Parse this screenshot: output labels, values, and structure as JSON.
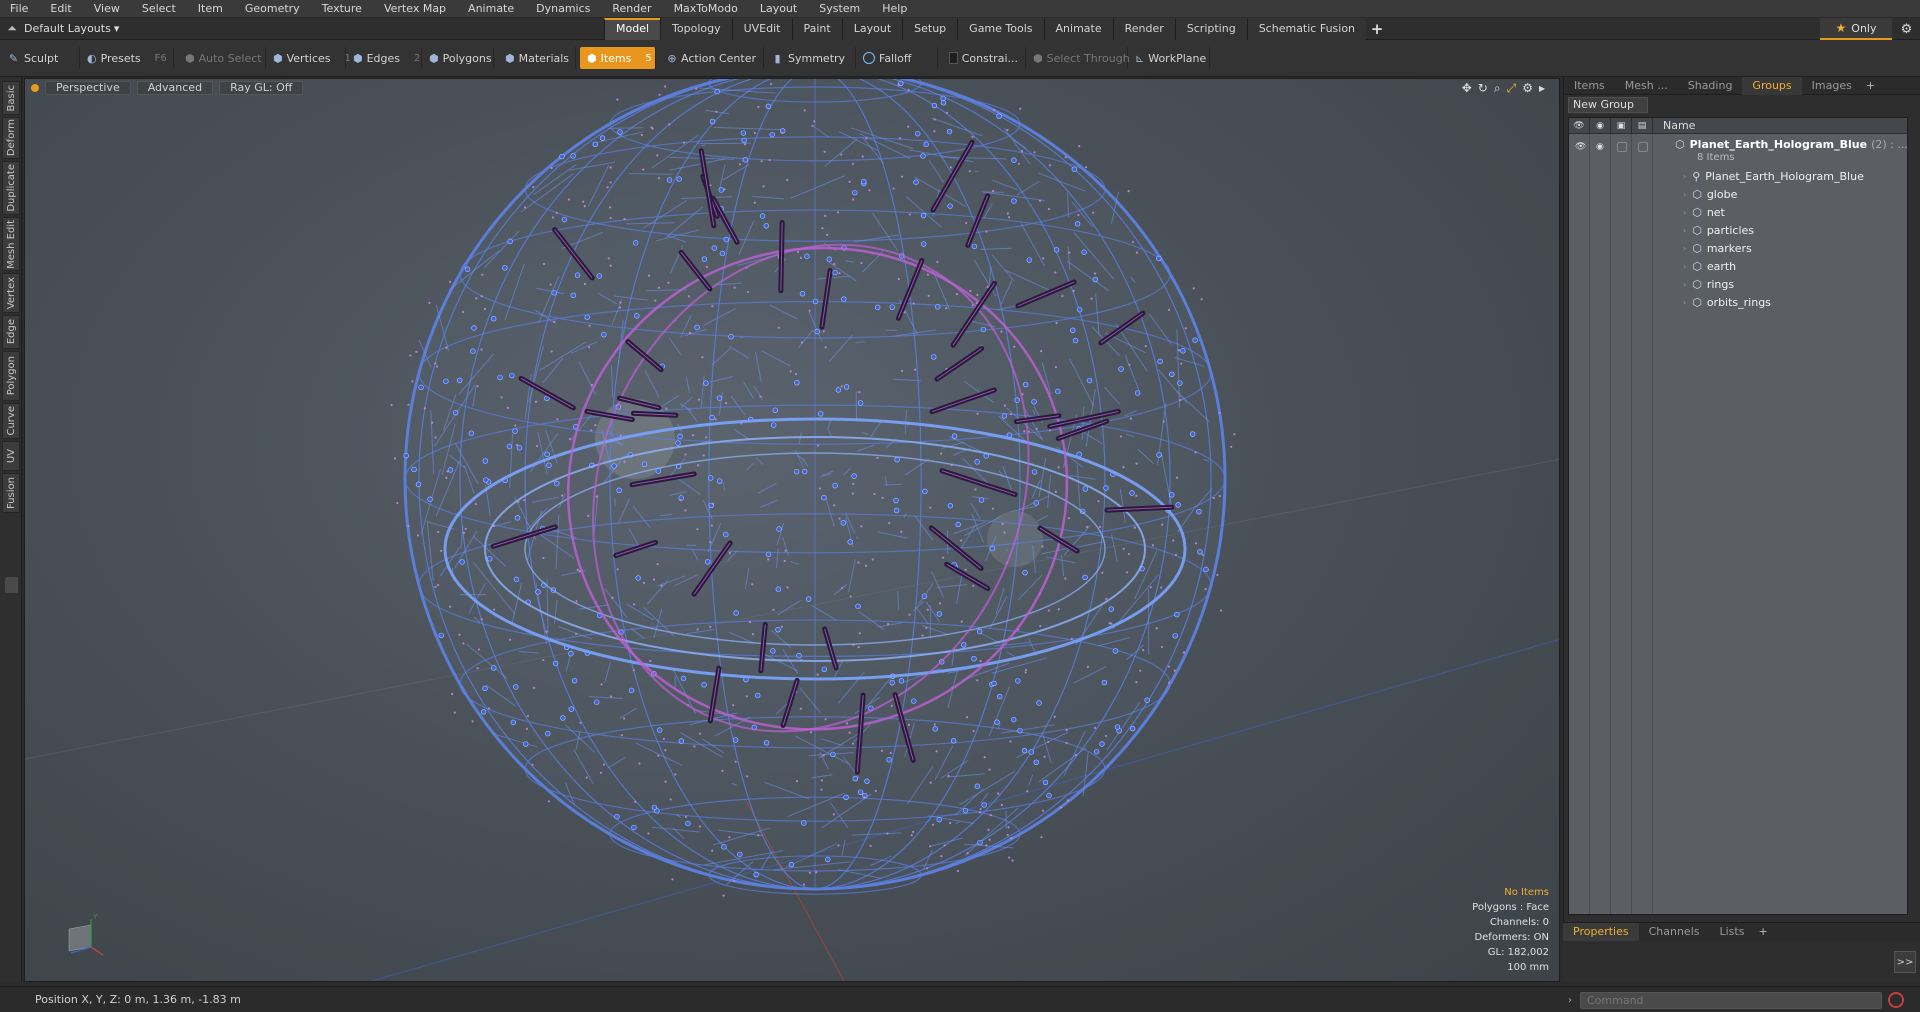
{
  "menu": [
    "File",
    "Edit",
    "View",
    "Select",
    "Item",
    "Geometry",
    "Texture",
    "Vertex Map",
    "Animate",
    "Dynamics",
    "Render",
    "MaxToModo",
    "Layout",
    "System",
    "Help"
  ],
  "layout": {
    "preset": "Default Layouts",
    "only_label": "Only"
  },
  "tabs": [
    {
      "label": "Model",
      "active": true
    },
    {
      "label": "Topology",
      "active": false
    },
    {
      "label": "UVEdit",
      "active": false
    },
    {
      "label": "Paint",
      "active": false
    },
    {
      "label": "Layout",
      "active": false
    },
    {
      "label": "Setup",
      "active": false
    },
    {
      "label": "Game Tools",
      "active": false
    },
    {
      "label": "Animate",
      "active": false
    },
    {
      "label": "Render",
      "active": false
    },
    {
      "label": "Scripting",
      "active": false
    },
    {
      "label": "Schematic Fusion",
      "active": false
    }
  ],
  "toolbar": {
    "sculpt": "Sculpt",
    "presets": "Presets",
    "presets_key": "F6",
    "auto_select": "Auto Select",
    "vertices": "Vertices",
    "vertices_num": "1",
    "edges": "Edges",
    "edges_num": "2",
    "polygons": "Polygons",
    "materials": "Materials",
    "items": "Items",
    "items_num": "5",
    "action_center": "Action Center",
    "symmetry": "Symmetry",
    "falloff": "Falloff",
    "constraints": "Constrai...",
    "select_through": "Select Through",
    "workplane": "WorkPlane"
  },
  "left_tabs": [
    "Basic",
    "Deform",
    "Duplicate",
    "Mesh Edit",
    "Vertex",
    "Edge",
    "Polygon",
    "Curve",
    "UV",
    "Fusion"
  ],
  "viewport": {
    "view": "Perspective",
    "shading": "Advanced",
    "raygl": "Ray GL: Off",
    "hud": {
      "selection": "No Items",
      "polygons": "Polygons : Face",
      "channels": "Channels: 0",
      "deformers": "Deformers: ON",
      "gl": "GL: 182,002",
      "grid": "100 mm"
    },
    "accent": "#e69a1e"
  },
  "right_panel": {
    "tabs": [
      "Items",
      "Mesh ...",
      "Shading",
      "Groups",
      "Images"
    ],
    "active_tab": "Groups",
    "new_group": "New Group",
    "name_col": "Name",
    "root": {
      "name": "Planet_Earth_Hologram_Blue",
      "count": "(2) : ...",
      "sub": "8 Items"
    },
    "children": [
      "Planet_Earth_Hologram_Blue",
      "globe",
      "net",
      "particles",
      "markers",
      "earth",
      "rings",
      "orbits_rings"
    ]
  },
  "bottom_panel": {
    "tabs": [
      "Properties",
      "Channels",
      "Lists"
    ],
    "active_tab": "Properties"
  },
  "status": {
    "position": "Position X, Y, Z:  0 m, 1.36 m, -1.83 m",
    "command_placeholder": "Command"
  }
}
